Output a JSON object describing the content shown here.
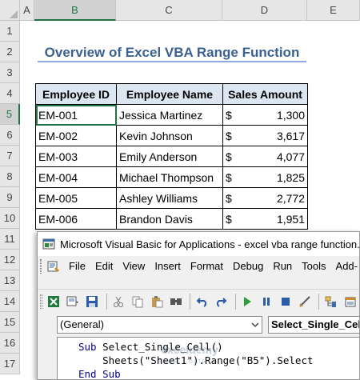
{
  "sheet": {
    "columns": [
      "A",
      "B",
      "C",
      "D",
      "E"
    ],
    "active_column": "B",
    "rows": [
      "1",
      "2",
      "3",
      "4",
      "5",
      "6",
      "7",
      "8",
      "9",
      "10",
      "11",
      "12",
      "13",
      "14",
      "15",
      "16",
      "17"
    ],
    "active_row": "5",
    "title": "Overview of Excel VBA Range Function",
    "table": {
      "headers": [
        "Employee ID",
        "Employee Name",
        "Sales Amount"
      ],
      "rows": [
        {
          "id": "EM-001",
          "name": "Jessica Martinez",
          "currency": "$",
          "amount": "1,300"
        },
        {
          "id": "EM-002",
          "name": "Kevin Johnson",
          "currency": "$",
          "amount": "3,617"
        },
        {
          "id": "EM-003",
          "name": "Emily Anderson",
          "currency": "$",
          "amount": "4,077"
        },
        {
          "id": "EM-004",
          "name": "Michael Thompson",
          "currency": "$",
          "amount": "1,825"
        },
        {
          "id": "EM-005",
          "name": "Ashley Williams",
          "currency": "$",
          "amount": "2,772"
        },
        {
          "id": "EM-006",
          "name": "Brandon Davis",
          "currency": "$",
          "amount": "1,951"
        }
      ]
    },
    "colors": {
      "accent": "#217346",
      "title": "#3a6191",
      "header_fill": "#dce6f1"
    }
  },
  "vbe": {
    "title": "Microsoft Visual Basic for Applications - excel vba range function.xlsm",
    "menu": [
      "File",
      "Edit",
      "View",
      "Insert",
      "Format",
      "Debug",
      "Run",
      "Tools",
      "Add-"
    ],
    "toolbar_icons": [
      "excel-icon",
      "insert-module-icon",
      "save-icon",
      "cut-icon",
      "copy-icon",
      "paste-icon",
      "find-icon",
      "undo-icon",
      "redo-icon",
      "run-icon",
      "break-icon",
      "reset-icon",
      "design-mode-icon",
      "project-explorer-icon",
      "properties-icon"
    ],
    "object_combo": "(General)",
    "procedure_combo": "Select_Single_Cell",
    "code": {
      "line1_kw": "Sub",
      "line1_rest": " Select_Single_Cell()",
      "line2": "    Sheets(\"Sheet1\").Range(\"B5\").Select",
      "line3_kw": "End Sub"
    },
    "watermark": {
      "main": "exceldemy",
      "sub": "EXCEL · DATA · BI"
    }
  }
}
